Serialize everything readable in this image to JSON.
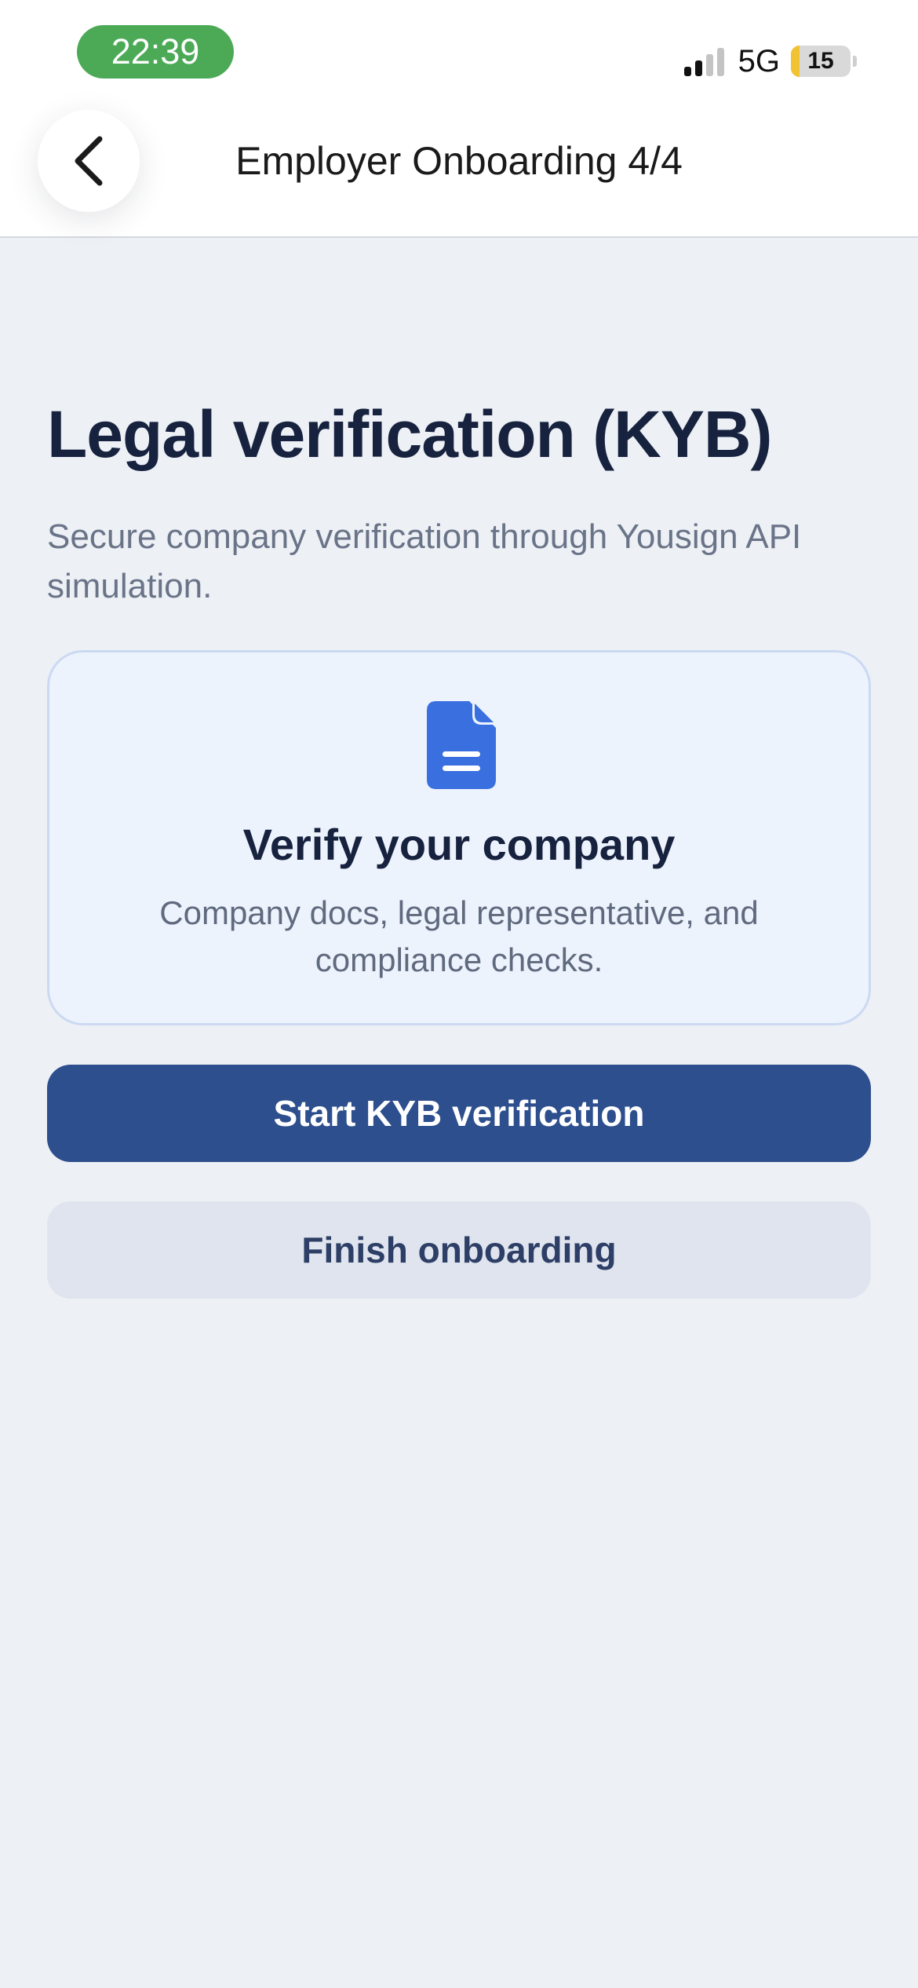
{
  "status_bar": {
    "time": "22:39",
    "time_pill_color": "#4caa57",
    "network": "5G",
    "signal_bars_active": 2,
    "signal_bars_total": 4,
    "battery_level": "15",
    "battery_fraction": 0.15,
    "battery_color": "#f1c232"
  },
  "nav": {
    "back_icon": "chevron-left-icon",
    "title": "Employer Onboarding 4/4"
  },
  "main": {
    "title": "Legal verification (KYB)",
    "subtitle": "Secure company verification through Yousign API simulation."
  },
  "card": {
    "icon": "document-icon",
    "icon_color": "#3a6fe0",
    "title": "Verify your company",
    "description": "Company docs, legal representative, and compliance checks."
  },
  "actions": {
    "primary_label": "Start KYB verification",
    "primary_color": "#2d4f8d",
    "secondary_label": "Finish onboarding"
  }
}
